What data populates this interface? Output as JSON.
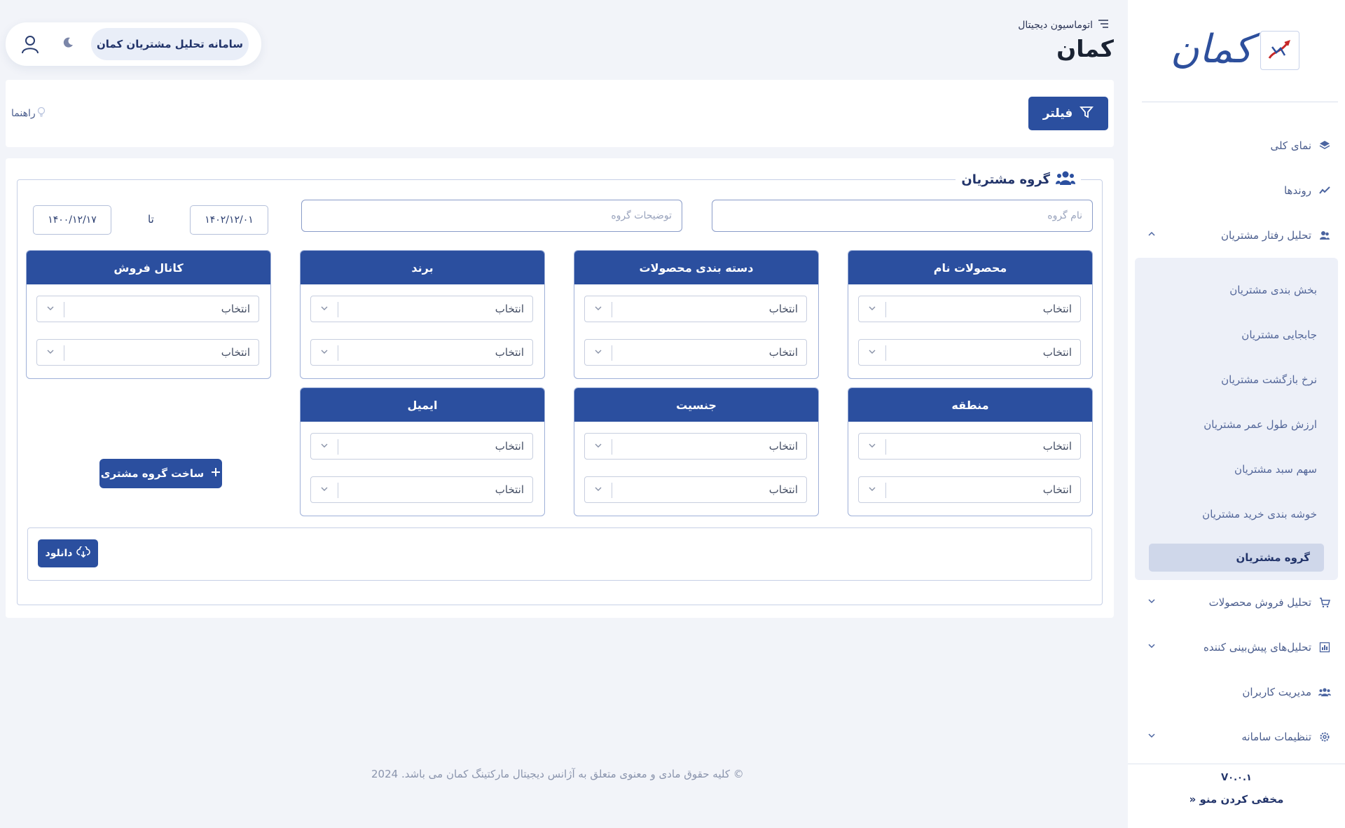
{
  "app": {
    "breadcrumb": "اتوماسیون دیجیتال",
    "page_title": "کمان",
    "logo_text": "کمان",
    "system_name": "سامانه تحلیل مشتریان کمان"
  },
  "sidebar": {
    "items": [
      {
        "label": "نمای کلی",
        "icon": "layers-icon"
      },
      {
        "label": "روندها",
        "icon": "trend-icon"
      },
      {
        "label": "تحلیل رفتار مشتریان",
        "icon": "users-icon",
        "expanded": true
      }
    ],
    "subitems": [
      "بخش بندی مشتریان",
      "جابجایی مشتریان",
      "نرخ بازگشت مشتریان",
      "ارزش طول عمر مشتریان",
      "سهم سبد مشتریان",
      "خوشه بندی خرید مشتریان"
    ],
    "active_subitem": "گروه مشتریان",
    "items_after": [
      {
        "label": "تحلیل فروش محصولات",
        "icon": "cart-icon",
        "chevron": true
      },
      {
        "label": "تحلیل‌های پیش‌بینی کننده",
        "icon": "chart-icon",
        "chevron": true
      },
      {
        "label": "مدیریت کاربران",
        "icon": "team-icon",
        "chevron": false
      },
      {
        "label": "تنظیمات سامانه",
        "icon": "gear-icon",
        "chevron": true
      }
    ],
    "version": "V۰.۰.۱",
    "hide_menu": "مخفی کردن منو"
  },
  "filterbar": {
    "filter_label": "فیلتر",
    "guide_label": "راهنما"
  },
  "group": {
    "title": "گروه مشتریان",
    "name_placeholder": "نام گروه",
    "desc_placeholder": "توضیحات گروه",
    "date_from": "۱۴۰۲/۱۲/۰۱",
    "to_label": "تا",
    "date_to": "۱۴۰۰/۱۲/۱۷",
    "select_placeholder": "انتخاب",
    "panels_row1": [
      "محصولات نام",
      "دسته بندی محصولات",
      "برند",
      "کانال فروش"
    ],
    "panels_row2": [
      "منطقه",
      "جنسیت",
      "ایمیل"
    ],
    "make_group": "ساخت گروه مشتری",
    "download": "دانلود"
  },
  "footer": "© کلیه حقوق مادی و معنوی متعلق به آژانس دیجیتال مارکتینگ کمان می باشد. 2024",
  "colors": {
    "primary": "#2b4f9f",
    "background": "#f2f4f9",
    "active_item": "#cfd7ea"
  }
}
